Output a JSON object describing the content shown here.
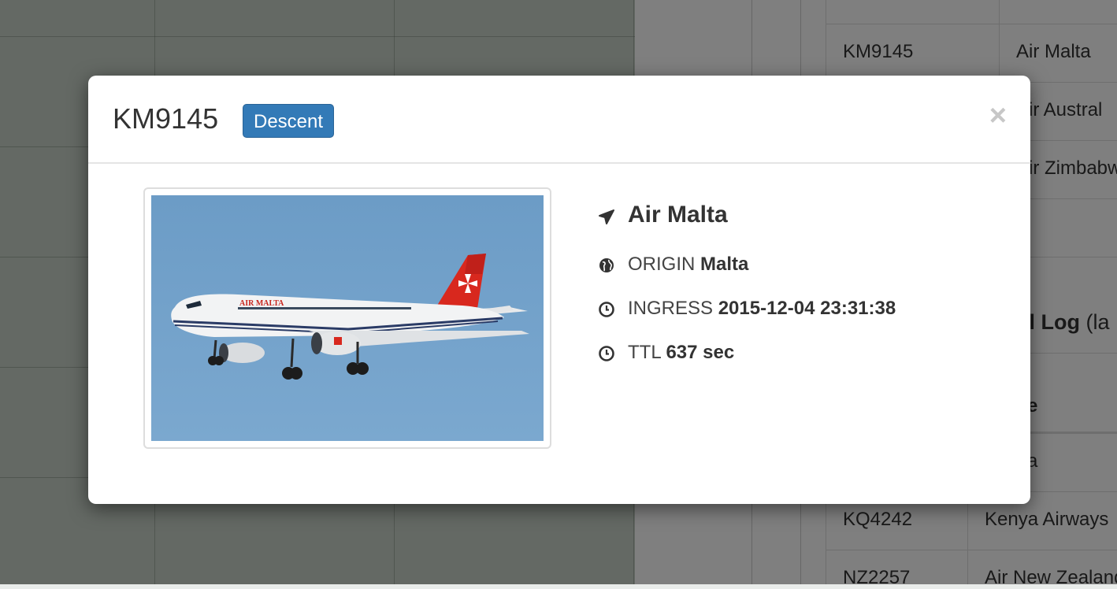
{
  "background": {
    "table_rows": [
      {
        "code": "KM9145",
        "airline": "Air Malta"
      },
      {
        "code": "",
        "airline": "Air Austral"
      },
      {
        "code": "",
        "airline": "Air Zimbabwe"
      }
    ],
    "log_heading": "ol Log",
    "log_heading_paren": "(la",
    "log_col_fragment": "e",
    "log_cell_fragment": "a",
    "log_rows": [
      {
        "code": "KQ4242",
        "airline": "Kenya Airways"
      },
      {
        "code": "NZ2257",
        "airline": "Air New Zealand"
      }
    ]
  },
  "modal": {
    "flight_code": "KM9145",
    "status": "Descent",
    "close_symbol": "×",
    "airline": "Air Malta",
    "origin_label": "ORIGIN",
    "origin_value": "Malta",
    "ingress_label": "INGRESS",
    "ingress_value": "2015-12-04 23:31:38",
    "ttl_label": "TTL",
    "ttl_value": "637 sec",
    "image_livery_text": "AIR MALTA",
    "icons": [
      "plane-icon",
      "globe-icon",
      "clock-icon",
      "clock-icon"
    ],
    "colors": {
      "status_badge": "#337ab7",
      "sky": "#6f9fc8",
      "tail": "#d8281e"
    }
  }
}
